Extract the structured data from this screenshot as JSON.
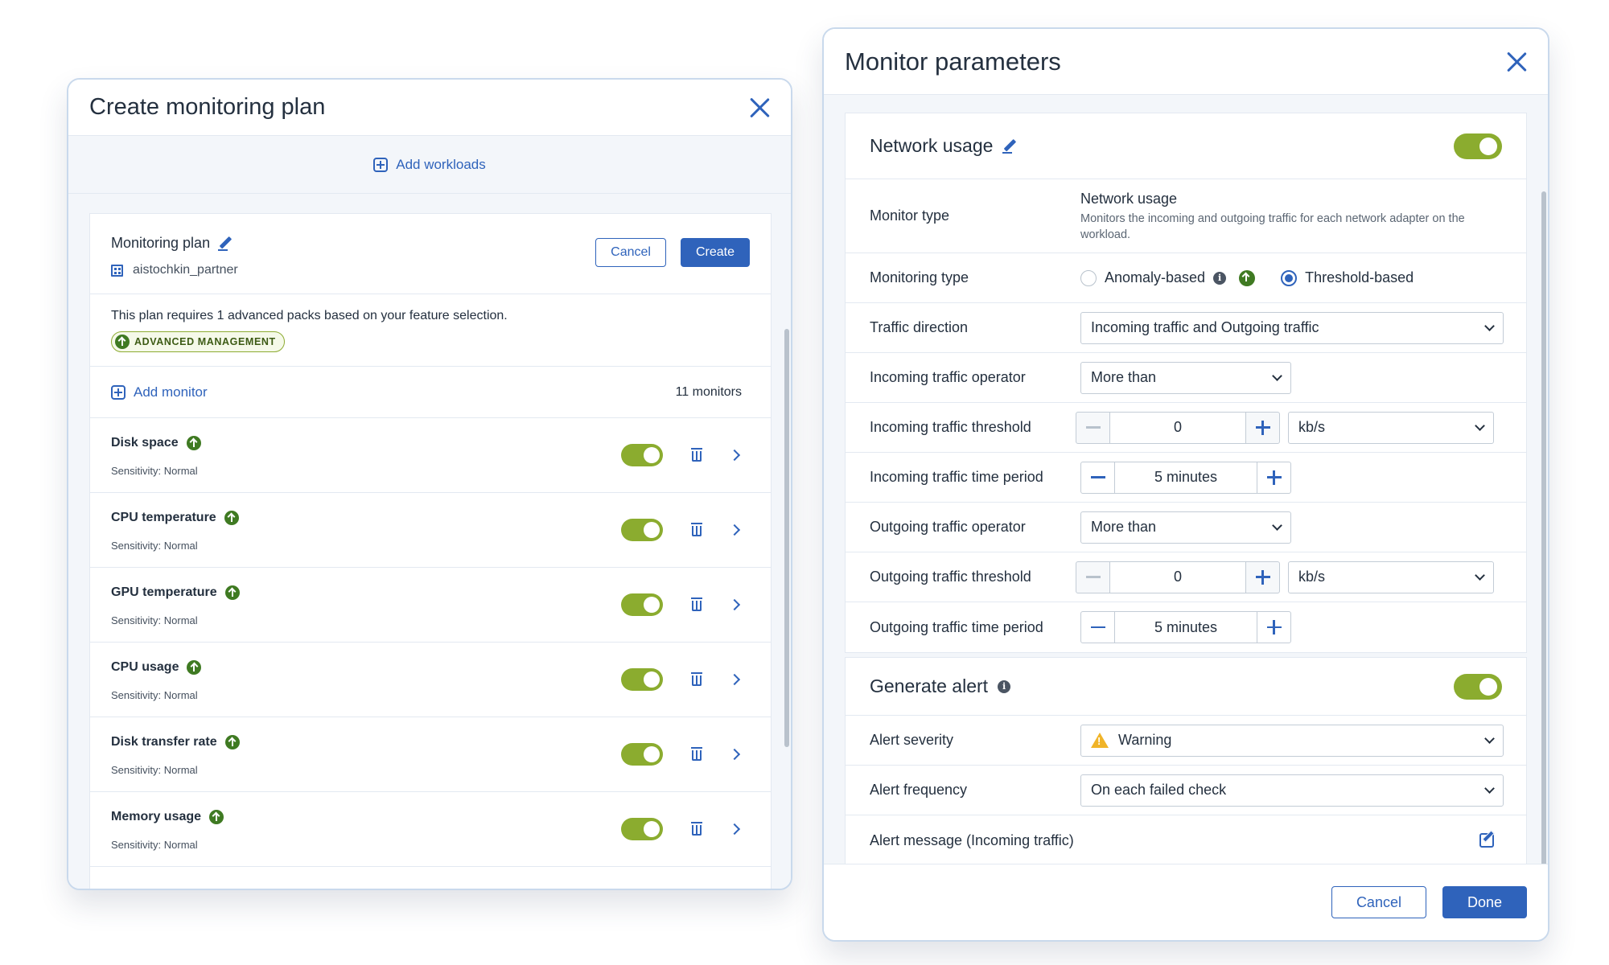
{
  "left_panel": {
    "title": "Create monitoring plan",
    "add_workloads": "Add workloads",
    "plan": {
      "name": "Monitoring plan",
      "tenant": "aistochkin_partner",
      "cancel_label": "Cancel",
      "create_label": "Create",
      "requirement_text": "This plan requires 1 advanced packs based on your feature selection.",
      "badge_label": "ADVANCED MANAGEMENT",
      "add_monitor_label": "Add monitor",
      "monitor_count": "11 monitors"
    },
    "monitors": [
      {
        "name": "Disk space",
        "sensitivity": "Sensitivity: Normal"
      },
      {
        "name": "CPU temperature",
        "sensitivity": "Sensitivity: Normal"
      },
      {
        "name": "GPU temperature",
        "sensitivity": "Sensitivity: Normal"
      },
      {
        "name": "CPU usage",
        "sensitivity": "Sensitivity: Normal"
      },
      {
        "name": "Disk transfer rate",
        "sensitivity": "Sensitivity: Normal"
      },
      {
        "name": "Memory usage",
        "sensitivity": "Sensitivity: Normal"
      }
    ]
  },
  "right_panel": {
    "title": "Monitor parameters",
    "network": {
      "title": "Network usage",
      "monitor_type_label": "Monitor type",
      "monitor_type_value": "Network usage",
      "monitor_type_desc": "Monitors the incoming and outgoing traffic for each network adapter on the workload.",
      "monitoring_type_label": "Monitoring type",
      "anomaly_label": "Anomaly-based",
      "threshold_label": "Threshold-based",
      "traffic_direction_label": "Traffic direction",
      "traffic_direction_value": "Incoming traffic and Outgoing traffic",
      "in_operator_label": "Incoming traffic operator",
      "in_operator_value": "More than",
      "in_threshold_label": "Incoming traffic threshold",
      "in_threshold_value": "0",
      "in_threshold_unit": "kb/s",
      "in_period_label": "Incoming traffic time period",
      "in_period_value": "5 minutes",
      "out_operator_label": "Outgoing traffic operator",
      "out_operator_value": "More than",
      "out_threshold_label": "Outgoing traffic threshold",
      "out_threshold_value": "0",
      "out_threshold_unit": "kb/s",
      "out_period_label": "Outgoing traffic time period",
      "out_period_value": "5 minutes"
    },
    "alert": {
      "title": "Generate alert",
      "severity_label": "Alert severity",
      "severity_value": "Warning",
      "frequency_label": "Alert frequency",
      "frequency_value": "On each failed check",
      "message_label": "Alert message (Incoming traffic)"
    },
    "cancel_label": "Cancel",
    "done_label": "Done"
  },
  "colors": {
    "accent": "#2f63bb",
    "toggle_on": "#8bac2f",
    "upgrade_icon": "#3f7a22",
    "warning": "#f0b429"
  },
  "icons": [
    "close-icon",
    "plus-box-icon",
    "pencil-icon",
    "building-icon",
    "upgrade-arrow-icon",
    "trash-icon",
    "chevron-right-icon",
    "chevron-down-icon",
    "info-icon",
    "warning-icon",
    "edit-icon",
    "plus-icon",
    "minus-icon"
  ]
}
